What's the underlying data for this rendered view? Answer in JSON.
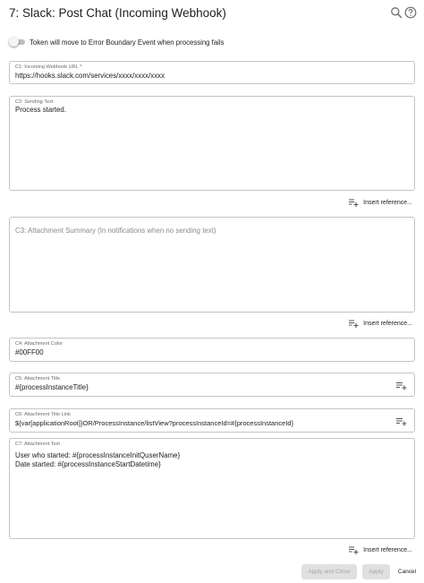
{
  "header": {
    "title": "7: Slack: Post Chat (Incoming Webhook)",
    "icons": [
      "search-icon",
      "help-icon"
    ]
  },
  "toggle": {
    "label": "Token will move to Error Boundary Event when processing fails",
    "checked": false
  },
  "fields": {
    "webhook_url": {
      "label": "C1: Incoming Webhook URL *",
      "value": "https://hooks.slack.com/services/xxxx/xxxx/xxxx"
    },
    "sending_text": {
      "label": "C2: Sending Text",
      "value": "Process started."
    },
    "attachment_summary": {
      "placeholder": "C3: Attachment Summary (In notifications when no sending text)"
    },
    "attachment_color": {
      "label": "C4: Attachment Color",
      "value": "#00FF00"
    },
    "attachment_title": {
      "label": "C5: Attachment Title",
      "value": "#{processInstanceTitle}"
    },
    "attachment_title_link": {
      "label": "C6: Attachment Title Link",
      "value": "${var[applicationRoot]}OR/ProcessInstance/listView?processInstanceId=#{processInstanceId}"
    },
    "attachment_text": {
      "label": "C7: Attachment Text",
      "value": "User who started: #{processInstanceInitQuserName}\nDate started: #{processInstanceStartDatetime}"
    }
  },
  "insert_reference_label": "Insert reference...",
  "footer": {
    "apply_close": "Apply and Close",
    "apply": "Apply",
    "cancel": "Cancel"
  },
  "colors": {
    "border": "#c4c4c4",
    "disabled_bg": "#e0e0e0",
    "disabled_text": "#a6a6a6"
  }
}
